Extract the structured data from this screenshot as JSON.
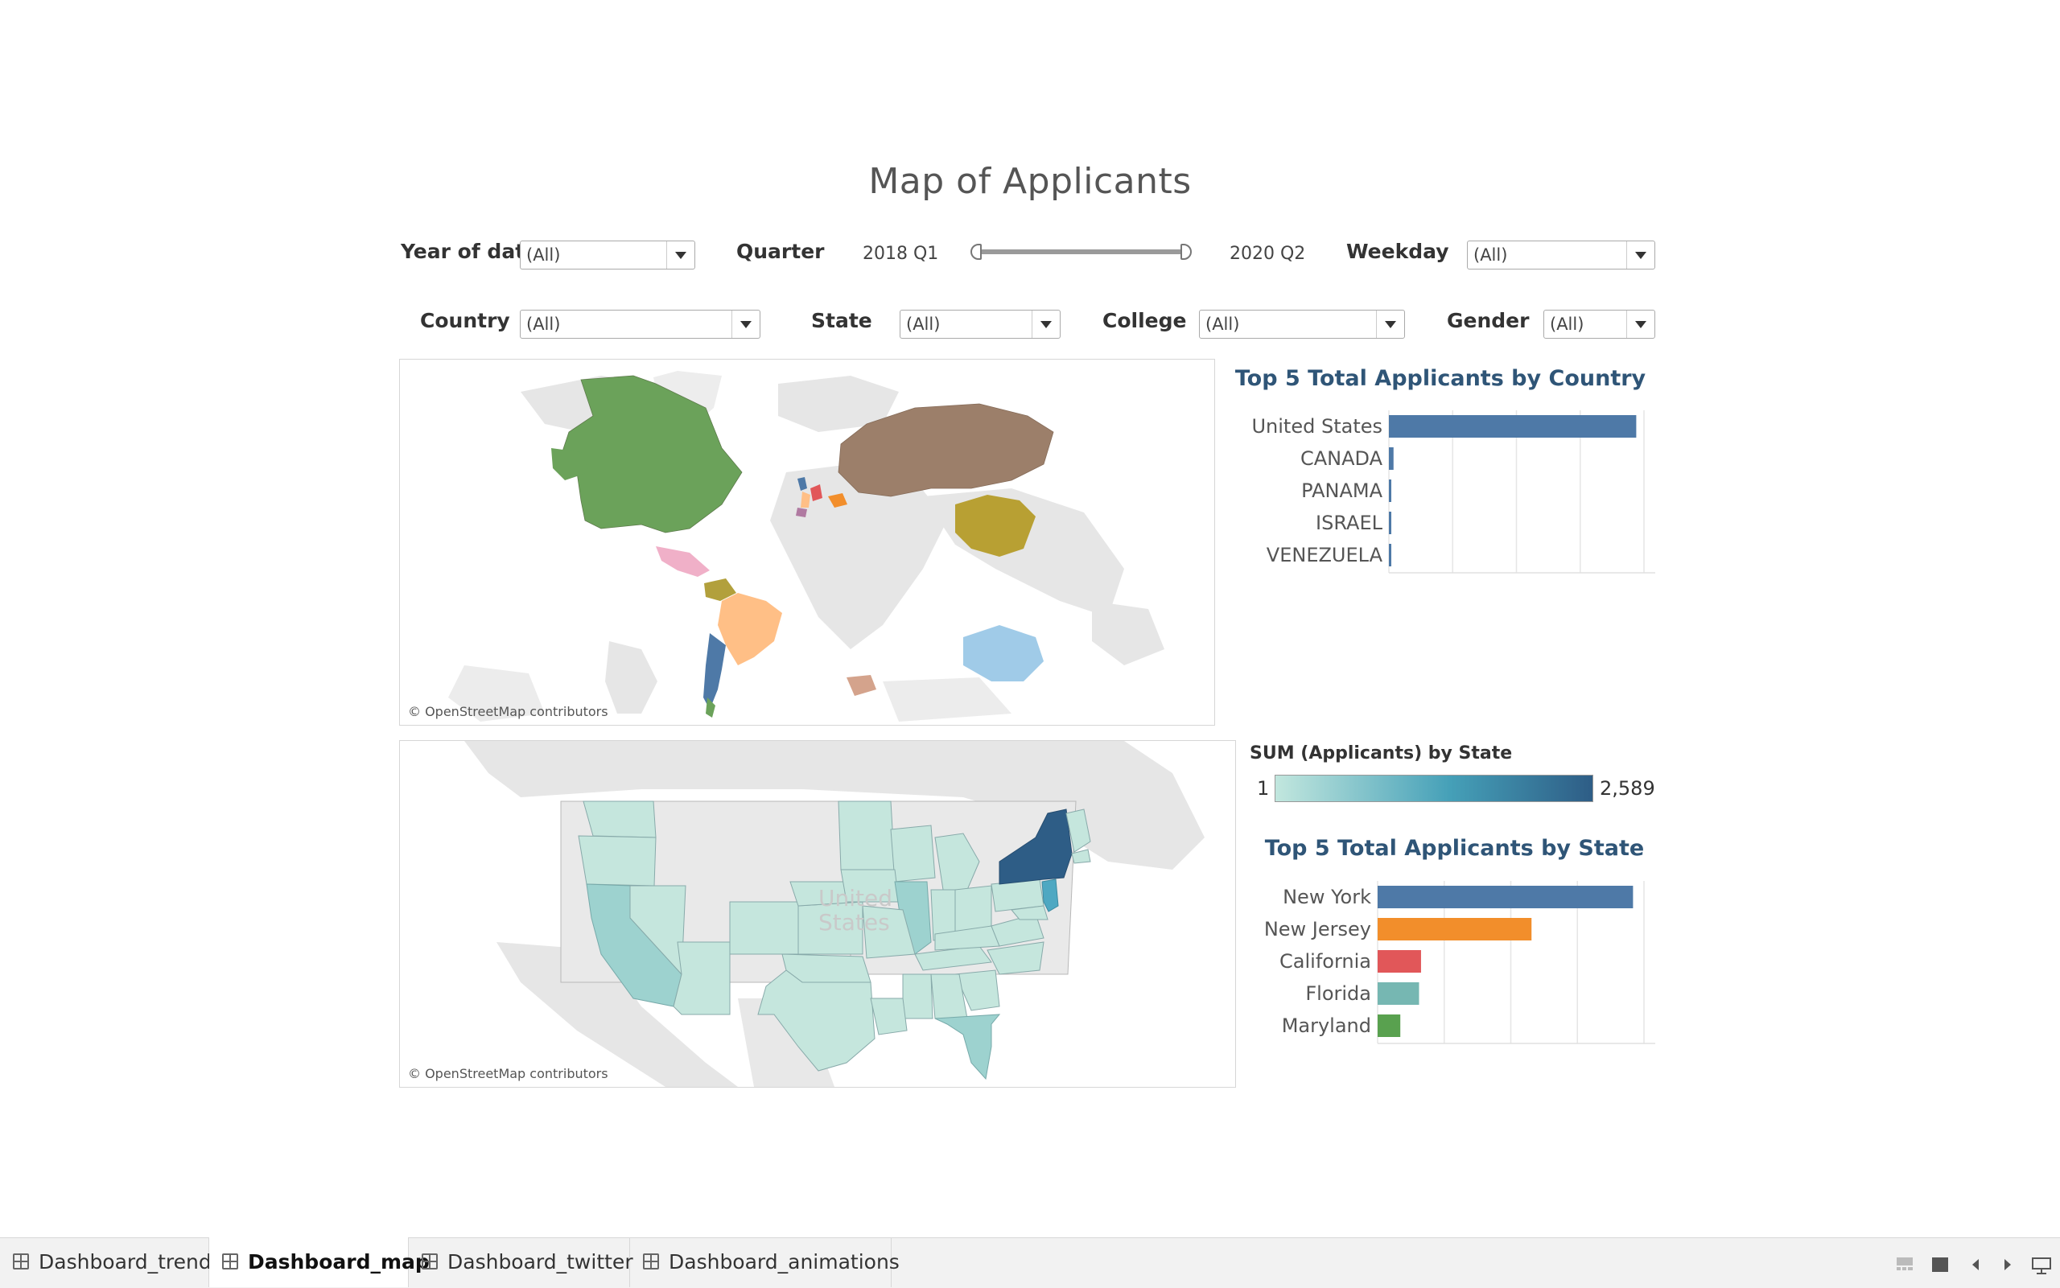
{
  "dashboard": {
    "title": "Map of Applicants"
  },
  "filters": {
    "year_label": "Year of date",
    "year_value": "(All)",
    "quarter_label": "Quarter",
    "quarter_start": "2018 Q1",
    "quarter_end": "2020 Q2",
    "weekday_label": "Weekday",
    "weekday_value": "(All)",
    "country_label": "Country",
    "country_value": "(All)",
    "state_label": "State",
    "state_value": "(All)",
    "college_label": "College",
    "college_value": "(All)",
    "gender_label": "Gender",
    "gender_value": "(All)"
  },
  "maps": {
    "world_credit": "© OpenStreetMap contributors",
    "us_credit": "© OpenStreetMap contributors",
    "us_label_line1": "United",
    "us_label_line2": "States"
  },
  "legend": {
    "title": "SUM (Applicants) by State",
    "min": "1",
    "max": "2,589",
    "color_low": "#bfe6dc",
    "color_high": "#2e5d86"
  },
  "chart_data": [
    {
      "type": "bar",
      "orientation": "horizontal",
      "title": "Top 5 Total Applicants by Country",
      "categories": [
        "United States",
        "CANADA",
        "PANAMA",
        "ISRAEL",
        "VENEZUELA"
      ],
      "values": [
        3200,
        60,
        30,
        25,
        10
      ],
      "colors": [
        "#4e79a7",
        "#4e79a7",
        "#4e79a7",
        "#4e79a7",
        "#4e79a7"
      ],
      "xlim": [
        0,
        3300
      ],
      "grid": true
    },
    {
      "type": "bar",
      "orientation": "horizontal",
      "title": "Top 5 Total Applicants by State",
      "categories": [
        "New York",
        "New Jersey",
        "California",
        "Florida",
        "Maryland"
      ],
      "values": [
        2589,
        1560,
        440,
        420,
        230
      ],
      "colors": [
        "#4e79a7",
        "#f28e2b",
        "#e15759",
        "#76b7b2",
        "#59a14f"
      ],
      "xlim": [
        0,
        2700
      ],
      "grid": true
    }
  ],
  "tabs": [
    {
      "label": "Dashboard_trend"
    },
    {
      "label": "Dashboard_map"
    },
    {
      "label": "Dashboard_twitter"
    },
    {
      "label": "Dashboard_animations"
    }
  ]
}
